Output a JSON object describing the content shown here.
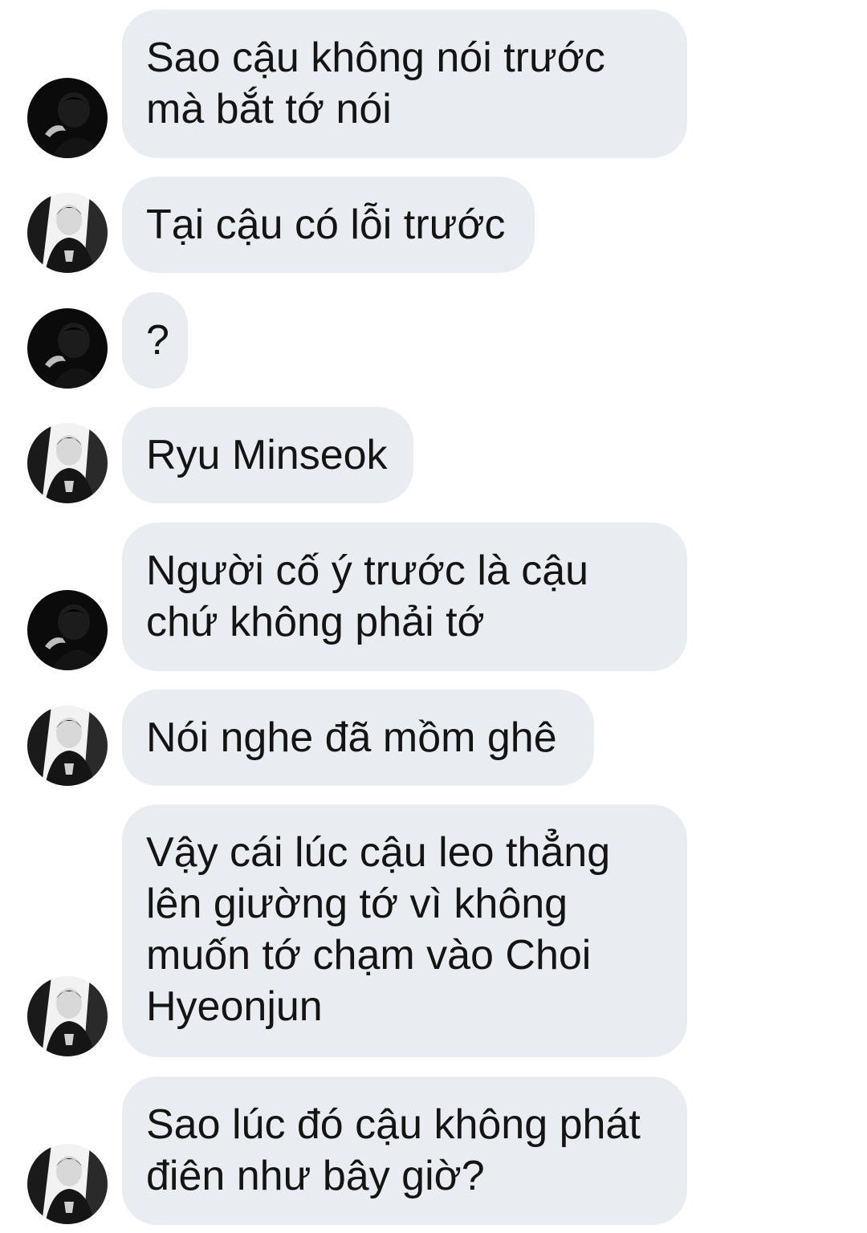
{
  "messages": [
    {
      "sender": "dark",
      "text": "Sao cậu không nói trước\nmà bắt tớ nói"
    },
    {
      "sender": "light",
      "text": "Tại cậu có lỗi trước"
    },
    {
      "sender": "dark",
      "text": "?"
    },
    {
      "sender": "light",
      "text": "Ryu Minseok"
    },
    {
      "sender": "dark",
      "text": "Người cố ý trước là cậu\nchứ không phải tớ"
    },
    {
      "sender": "light",
      "text": "Nói nghe đã mồm ghê"
    },
    {
      "sender": "light",
      "text": "Vậy cái lúc cậu leo thẳng\nlên giường tớ vì không\nmuốn tớ chạm vào Choi\nHyeonjun"
    },
    {
      "sender": "light",
      "text": "Sao lúc đó cậu không phát\nđiên như bây giờ?"
    }
  ],
  "avatars": {
    "dark": {
      "icon": "dark-portrait-avatar"
    },
    "light": {
      "icon": "monochrome-portrait-avatar"
    }
  },
  "colors": {
    "bubble": "#e9ecf0",
    "text": "#141414",
    "background": "#ffffff"
  }
}
